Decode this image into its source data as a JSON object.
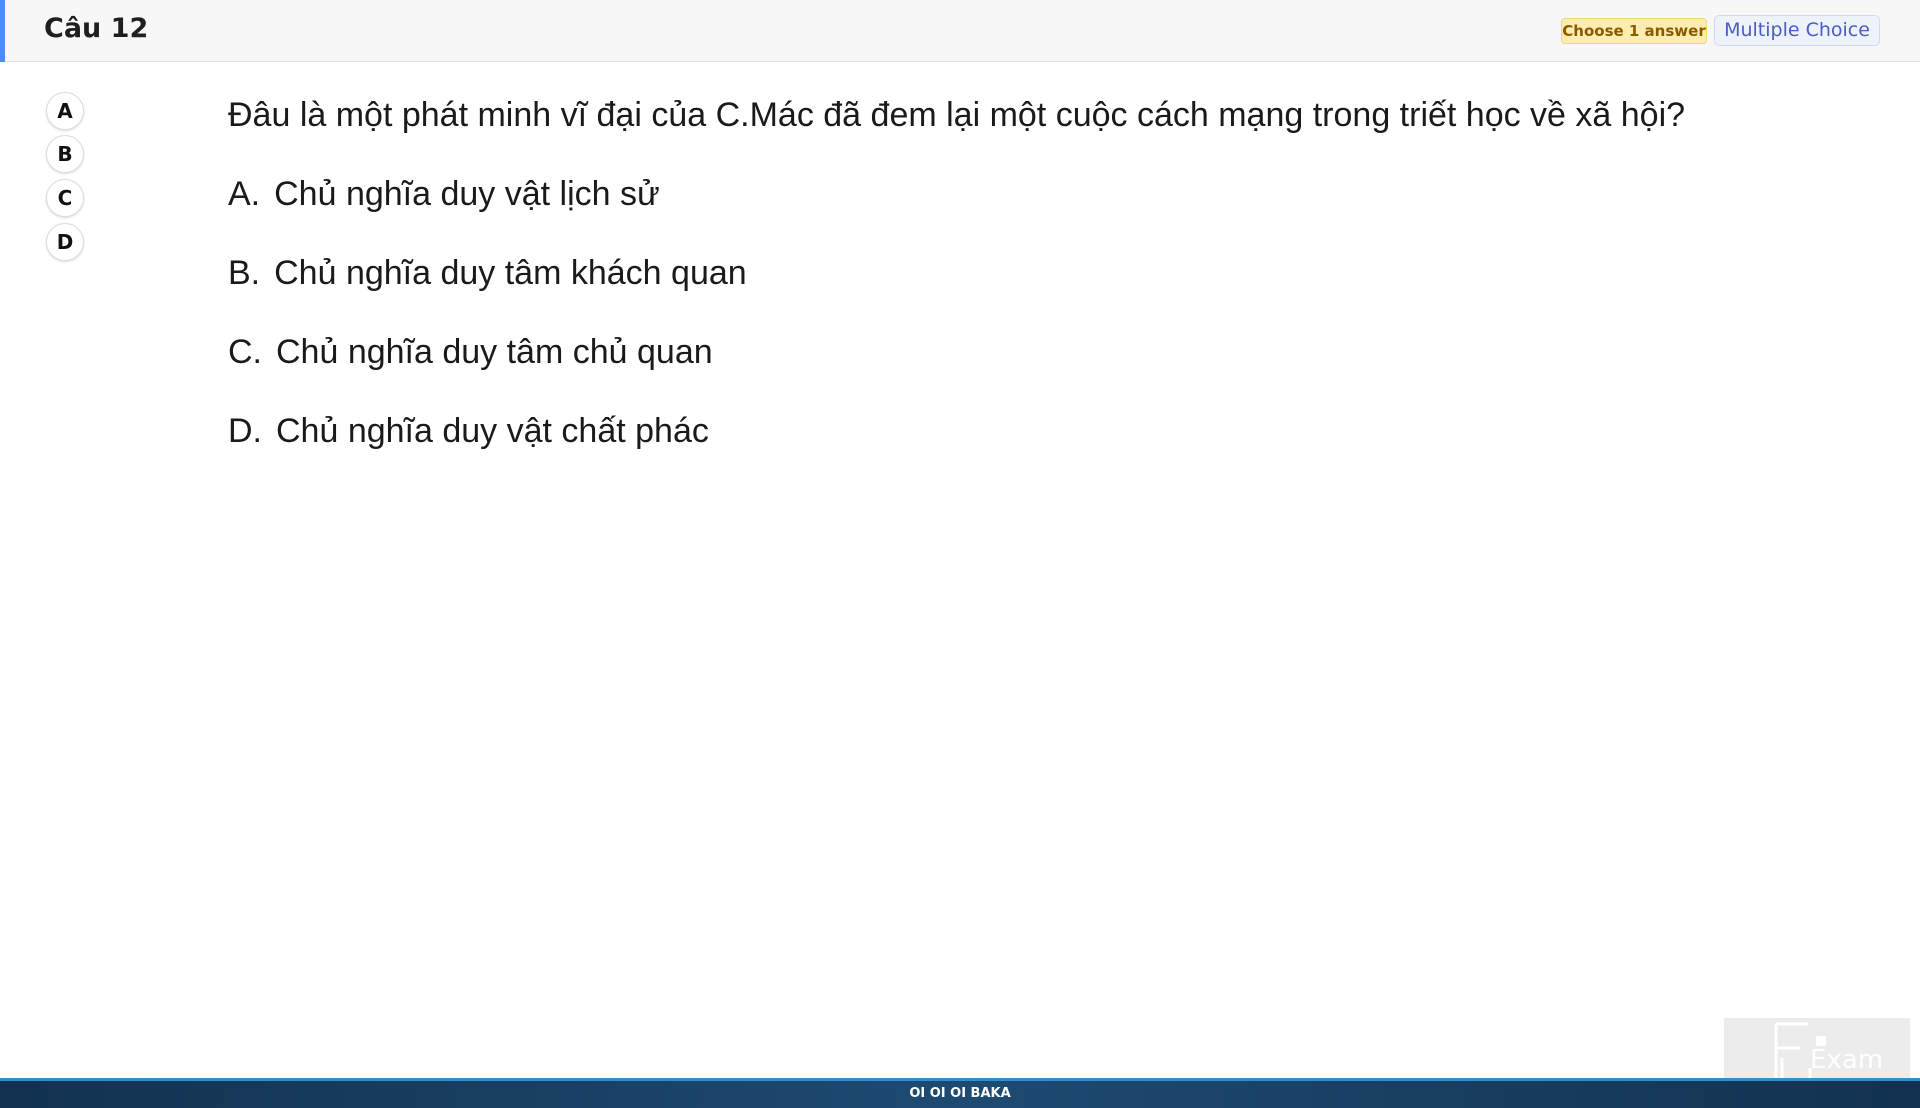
{
  "header": {
    "question_number": "Câu 12",
    "badge_choose": "Choose 1 answer",
    "badge_type": "Multiple Choice"
  },
  "answer_buttons": [
    {
      "label": "A"
    },
    {
      "label": "B"
    },
    {
      "label": "C"
    },
    {
      "label": "D"
    }
  ],
  "question": {
    "text": "Đâu là một phát minh vĩ đại của C.Mác đã đem lại một cuộc cách mạng trong triết học về xã hội?",
    "options": [
      {
        "letter": "A.",
        "text": "Chủ nghĩa duy vật lịch sử"
      },
      {
        "letter": "B.",
        "text": "Chủ nghĩa duy tâm khách quan"
      },
      {
        "letter": "C.",
        "text": "Chủ nghĩa duy tâm chủ quan"
      },
      {
        "letter": "D.",
        "text": "Chủ nghĩa duy vật chất phác"
      }
    ]
  },
  "footer": {
    "text": "OI OI OI BAKA"
  },
  "logo": {
    "text": "Exam",
    "icon": "fu-exam-logo-icon"
  },
  "colors": {
    "header_accent": "#4a8ff0",
    "badge_choose_bg": "#fdecb0",
    "badge_type_text": "#4b5dc0",
    "footer_bg": "#1e4a72"
  }
}
